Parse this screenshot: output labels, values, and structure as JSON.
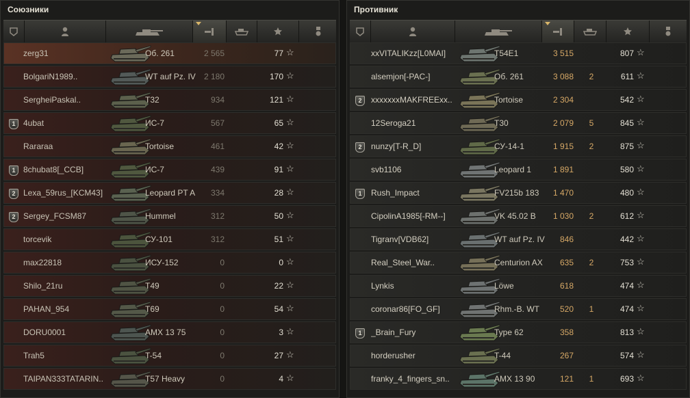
{
  "allies": {
    "title": "Союзники",
    "sorted_column": "damage",
    "rows": [
      {
        "badge": "",
        "name": "zerg31",
        "vehicle": "Об. 261",
        "damage": "2 565",
        "xp": "77",
        "tank_color": "#6b6a5a"
      },
      {
        "badge": "",
        "name": "BolgariN1989..",
        "vehicle": "WT auf Pz. IV",
        "damage": "2 180",
        "xp": "170",
        "tank_color": "#535a58"
      },
      {
        "badge": "",
        "name": "SergheiPaskal..",
        "vehicle": "T32",
        "damage": "934",
        "xp": "121",
        "tank_color": "#5c604c"
      },
      {
        "badge": "1",
        "name": "4ubat",
        "vehicle": "ИС-7",
        "damage": "567",
        "xp": "65",
        "tank_color": "#50583f"
      },
      {
        "badge": "",
        "name": "Rararaa",
        "vehicle": "Tortoise",
        "damage": "461",
        "xp": "42",
        "tank_color": "#6a6650"
      },
      {
        "badge": "1",
        "name": "8chubat8[_CCB]",
        "vehicle": "ИС-7",
        "damage": "439",
        "xp": "91",
        "tank_color": "#50583f"
      },
      {
        "badge": "2",
        "name": "Lexa_59rus_[KCM43]",
        "vehicle": "Leopard PT A",
        "damage": "334",
        "xp": "28",
        "tank_color": "#5a6250"
      },
      {
        "badge": "2",
        "name": "Sergey_FCSM87",
        "vehicle": "Hummel",
        "damage": "312",
        "xp": "50",
        "tank_color": "#4f5548"
      },
      {
        "badge": "",
        "name": "torcevik",
        "vehicle": "СУ-101",
        "damage": "312",
        "xp": "51",
        "tank_color": "#4c543d"
      },
      {
        "badge": "",
        "name": "max22818",
        "vehicle": "ИСУ-152",
        "damage": "0",
        "xp": "0",
        "tank_color": "#4a5140"
      },
      {
        "badge": "",
        "name": "Shilo_21ru",
        "vehicle": "T49",
        "damage": "0",
        "xp": "22",
        "tank_color": "#505444"
      },
      {
        "badge": "",
        "name": "PAHAN_954",
        "vehicle": "T69",
        "damage": "0",
        "xp": "54",
        "tank_color": "#545848"
      },
      {
        "badge": "",
        "name": "DORU0001",
        "vehicle": "AMX 13 75",
        "damage": "0",
        "xp": "3",
        "tank_color": "#4d5550"
      },
      {
        "badge": "",
        "name": "Trah5",
        "vehicle": "T-54",
        "damage": "0",
        "xp": "27",
        "tank_color": "#4b5340"
      },
      {
        "badge": "",
        "name": "TAIPAN333TATARIN..",
        "vehicle": "T57 Heavy",
        "damage": "0",
        "xp": "4",
        "tank_color": "#555549"
      }
    ]
  },
  "enemies": {
    "title": "Противник",
    "sorted_column": "damage",
    "rows": [
      {
        "badge": "",
        "name": "xxVITALIKzz[L0MAI]",
        "vehicle": "T54E1",
        "damage": "3 515",
        "kills": "",
        "xp": "807",
        "tank_color": "#6d7570"
      },
      {
        "badge": "",
        "name": "alsemjon[-PAC-]",
        "vehicle": "Об. 261",
        "damage": "3 088",
        "kills": "2",
        "xp": "611",
        "tank_color": "#6a7050"
      },
      {
        "badge": "2",
        "name": "xxxxxxxMAKFREExx..",
        "vehicle": "Tortoise",
        "damage": "2 304",
        "kills": "",
        "xp": "542",
        "tank_color": "#7a7458"
      },
      {
        "badge": "",
        "name": "12Seroga21",
        "vehicle": "T30",
        "damage": "2 079",
        "kills": "5",
        "xp": "845",
        "tank_color": "#6f6a55"
      },
      {
        "badge": "2",
        "name": "nunzy[T-R_D]",
        "vehicle": "СУ-14-1",
        "damage": "1 915",
        "kills": "2",
        "xp": "875",
        "tank_color": "#606a48"
      },
      {
        "badge": "",
        "name": "svb1106",
        "vehicle": "Leopard 1",
        "damage": "1 891",
        "kills": "",
        "xp": "580",
        "tank_color": "#707474"
      },
      {
        "badge": "1",
        "name": "Rush_Impact",
        "vehicle": "FV215b 183",
        "damage": "1 470",
        "kills": "",
        "xp": "480",
        "tank_color": "#7a7660"
      },
      {
        "badge": "",
        "name": "CipolinA1985[-RM--]",
        "vehicle": "VK 45.02 B",
        "damage": "1 030",
        "kills": "2",
        "xp": "612",
        "tank_color": "#6d716e"
      },
      {
        "badge": "",
        "name": "Tigranv[VDB62]",
        "vehicle": "WT auf Pz. IV",
        "damage": "846",
        "kills": "",
        "xp": "442",
        "tank_color": "#6a7070"
      },
      {
        "badge": "",
        "name": "Real_Steel_War..",
        "vehicle": "Centurion AX",
        "damage": "635",
        "kills": "2",
        "xp": "753",
        "tank_color": "#767058"
      },
      {
        "badge": "",
        "name": "Lynkis",
        "vehicle": "Löwe",
        "damage": "618",
        "kills": "",
        "xp": "474",
        "tank_color": "#6e7272"
      },
      {
        "badge": "",
        "name": "coronar86[FO_GF]",
        "vehicle": "Rhm.-B. WT",
        "damage": "520",
        "kills": "1",
        "xp": "474",
        "tank_color": "#707372"
      },
      {
        "badge": "1",
        "name": "_Brain_Fury",
        "vehicle": "Type 62",
        "damage": "358",
        "kills": "",
        "xp": "813",
        "tank_color": "#6a7a50"
      },
      {
        "badge": "",
        "name": "horderusher",
        "vehicle": "T-44",
        "damage": "267",
        "kills": "",
        "xp": "574",
        "tank_color": "#6a7050"
      },
      {
        "badge": "",
        "name": "franky_4_fingers_sn..",
        "vehicle": "AMX 13 90",
        "damage": "121",
        "kills": "1",
        "xp": "693",
        "tank_color": "#5c7468"
      }
    ]
  }
}
